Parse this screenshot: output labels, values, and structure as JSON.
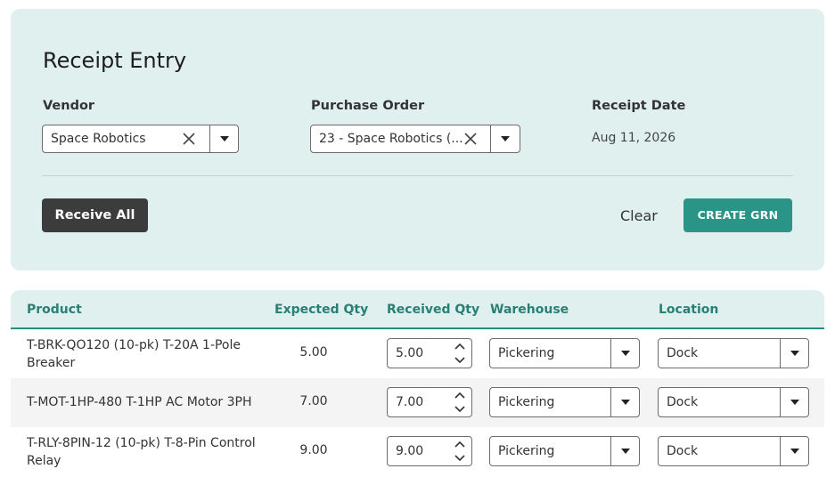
{
  "header": {
    "title": "Receipt Entry",
    "vendor": {
      "label": "Vendor",
      "value": "Space Robotics"
    },
    "purchase_order": {
      "label": "Purchase Order",
      "value": "23 - Space Robotics (..."
    },
    "receipt_date": {
      "label": "Receipt Date",
      "value": "Aug 11, 2026"
    }
  },
  "actions": {
    "receive_all": "Receive All",
    "clear": "Clear",
    "create_grn": "CREATE GRN"
  },
  "table": {
    "columns": [
      "Product",
      "Expected Qty",
      "Received Qty",
      "Warehouse",
      "Location"
    ],
    "rows": [
      {
        "product_line1": "T-BRK-QO120 (10-pk) T-20A 1-Pole",
        "product_line2": "Breaker",
        "expected": "5.00",
        "received": "5.00",
        "warehouse": "Pickering",
        "location": "Dock"
      },
      {
        "product_line1": "T-MOT-1HP-480 T-1HP AC Motor 3PH",
        "product_line2": "",
        "expected": "7.00",
        "received": "7.00",
        "warehouse": "Pickering",
        "location": "Dock"
      },
      {
        "product_line1": "T-RLY-8PIN-12 (10-pk) T-8-Pin Control",
        "product_line2": "Relay",
        "expected": "9.00",
        "received": "9.00",
        "warehouse": "Pickering",
        "location": "Dock"
      }
    ]
  },
  "colors": {
    "panel": "#dff0ee",
    "accent": "#2a9487",
    "dark_button": "#3c3c3c",
    "header_text": "#2a7f73"
  },
  "icons": {
    "clear": "close-icon",
    "dropdown": "chevron-down-icon",
    "spinner": "stepper-icon"
  }
}
